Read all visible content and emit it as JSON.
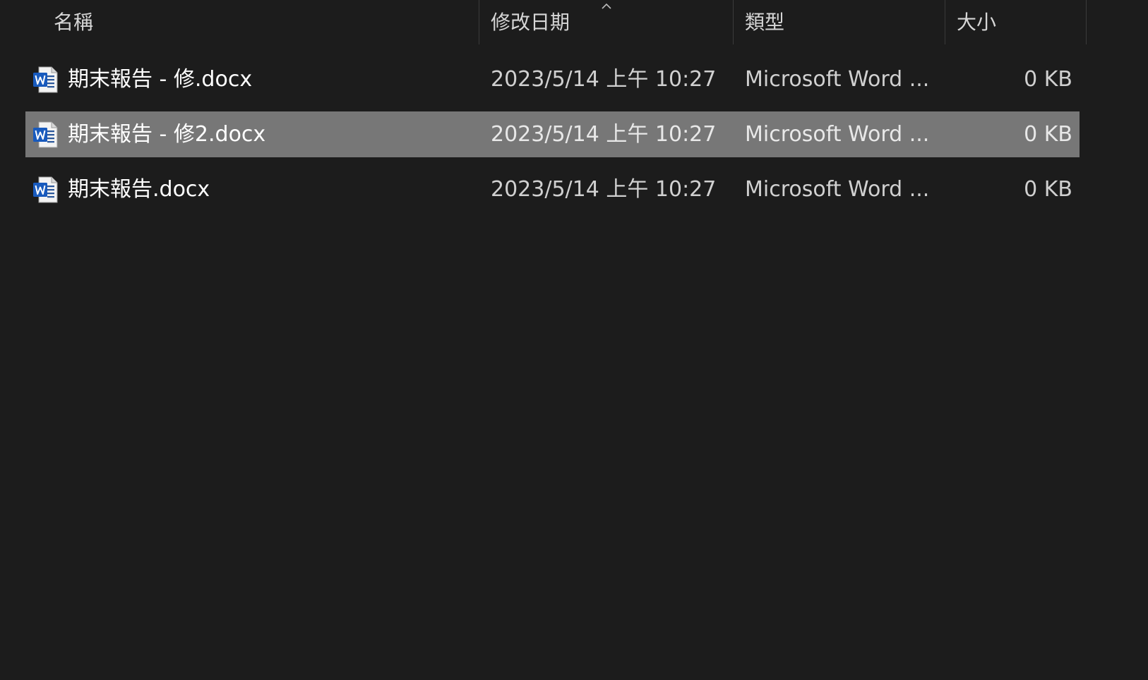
{
  "columns": {
    "name": "名稱",
    "modified": "修改日期",
    "type": "類型",
    "size": "大小"
  },
  "sort": {
    "column": "modified",
    "direction": "ascending",
    "icon": "chevron-up-icon"
  },
  "files": [
    {
      "name": "期末報告 - 修.docx",
      "modified": "2023/5/14 上午 10:27",
      "type": "Microsoft Word ...",
      "size": "0 KB",
      "icon": "word-document-icon",
      "selected": false
    },
    {
      "name": "期末報告 - 修2.docx",
      "modified": "2023/5/14 上午 10:27",
      "type": "Microsoft Word ...",
      "size": "0 KB",
      "icon": "word-document-icon",
      "selected": true
    },
    {
      "name": "期末報告.docx",
      "modified": "2023/5/14 上午 10:27",
      "type": "Microsoft Word ...",
      "size": "0 KB",
      "icon": "word-document-icon",
      "selected": false
    }
  ],
  "colors": {
    "background": "#1c1c1c",
    "selection": "#777777",
    "word_blue": "#185abd"
  }
}
